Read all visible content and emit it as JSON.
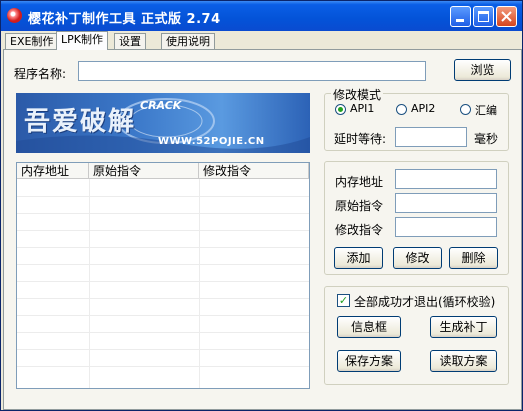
{
  "window": {
    "title": "樱花补丁制作工具  正式版  2.74"
  },
  "tabs": [
    "EXE制作",
    "LPK制作",
    "设置",
    "使用说明"
  ],
  "program": {
    "label": "程序名称:",
    "value": "",
    "browse_label": "浏览"
  },
  "banner": {
    "logo_text": "吾爱破解",
    "crack_text": "CRACK",
    "url_text": "WWW.52POJIE.CN"
  },
  "mode": {
    "legend": "修改模式",
    "options": [
      "API1",
      "API2",
      "汇编"
    ],
    "selected": "API1",
    "delay_label": "延时等待:",
    "delay_value": "",
    "delay_unit": "毫秒"
  },
  "table": {
    "columns": [
      "内存地址",
      "原始指令",
      "修改指令"
    ],
    "rows": []
  },
  "edit": {
    "address_label": "内存地址",
    "original_label": "原始指令",
    "modified_label": "修改指令",
    "add_label": "添加",
    "modify_label": "修改",
    "delete_label": "删除"
  },
  "actions": {
    "exit_check_label": "全部成功才退出(循环校验)",
    "exit_check_checked": true,
    "msgbox_label": "信息框",
    "generate_label": "生成补丁",
    "save_label": "保存方案",
    "load_label": "读取方案"
  },
  "colors": {
    "title_bar": "#0453d8",
    "face": "#ece9d8",
    "radio_dot": "#21a121",
    "close_button": "#d6451f"
  }
}
